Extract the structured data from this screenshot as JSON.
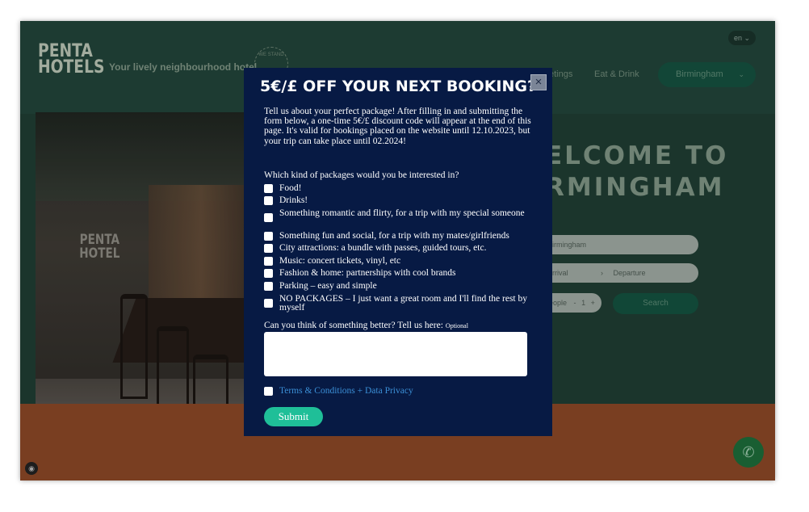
{
  "header": {
    "logo_line1": "PENTA",
    "logo_line2": "HOTELS",
    "tagline": "Your lively neighbourhood hotel",
    "stamp_text": "WE STAND",
    "language": "en",
    "nav": [
      "etings",
      "Eat & Drink"
    ],
    "city_button": "Birmingham"
  },
  "hero": {
    "image_logo_line1": "PENTA",
    "image_logo_line2": "HOTEL",
    "welcome_line1": "ELCOME TO",
    "welcome_line2": "RMINGHAM"
  },
  "booking": {
    "hotel_value": "irmingham",
    "arrival_label": "rrival",
    "departure_label": "Departure",
    "people_label": "eople",
    "people_count": "1",
    "search_label": "Search"
  },
  "modal": {
    "title": "5€/£ OFF YOUR NEXT BOOKING?",
    "close_label": "×",
    "intro": "Tell us about your perfect package! After filling in and submitting the form below, a one-time 5€/£ discount code will appear at the end of this page. It's valid for bookings placed on the website until 12.10.2023, but your trip can take place until 02.2024!",
    "question": "Which kind of packages would you be interested in?",
    "options": [
      "Food!",
      "Drinks!",
      "Something romantic and flirty, for a trip with my special someone",
      "Something fun and social, for a trip with my mates/girlfriends",
      "City attractions: a bundle with passes, guided tours, etc.",
      "Music: concert tickets, vinyl, etc",
      "Fashion & home: partnerships with cool brands",
      "Parking – easy and simple",
      "NO PACKAGES – I just want a great room and I'll find the rest by myself"
    ],
    "better_label": "Can you think of something better? Tell us here:",
    "optional_label": "Optional",
    "terms_label": "Terms & Conditions + Data Privacy",
    "submit_label": "Submit"
  },
  "colors": {
    "modal_bg": "#071a44",
    "submit_bg": "#1fbf98",
    "link": "#3b8fd6",
    "header_bg": "#22443a",
    "band_orange": "#8a4726"
  }
}
